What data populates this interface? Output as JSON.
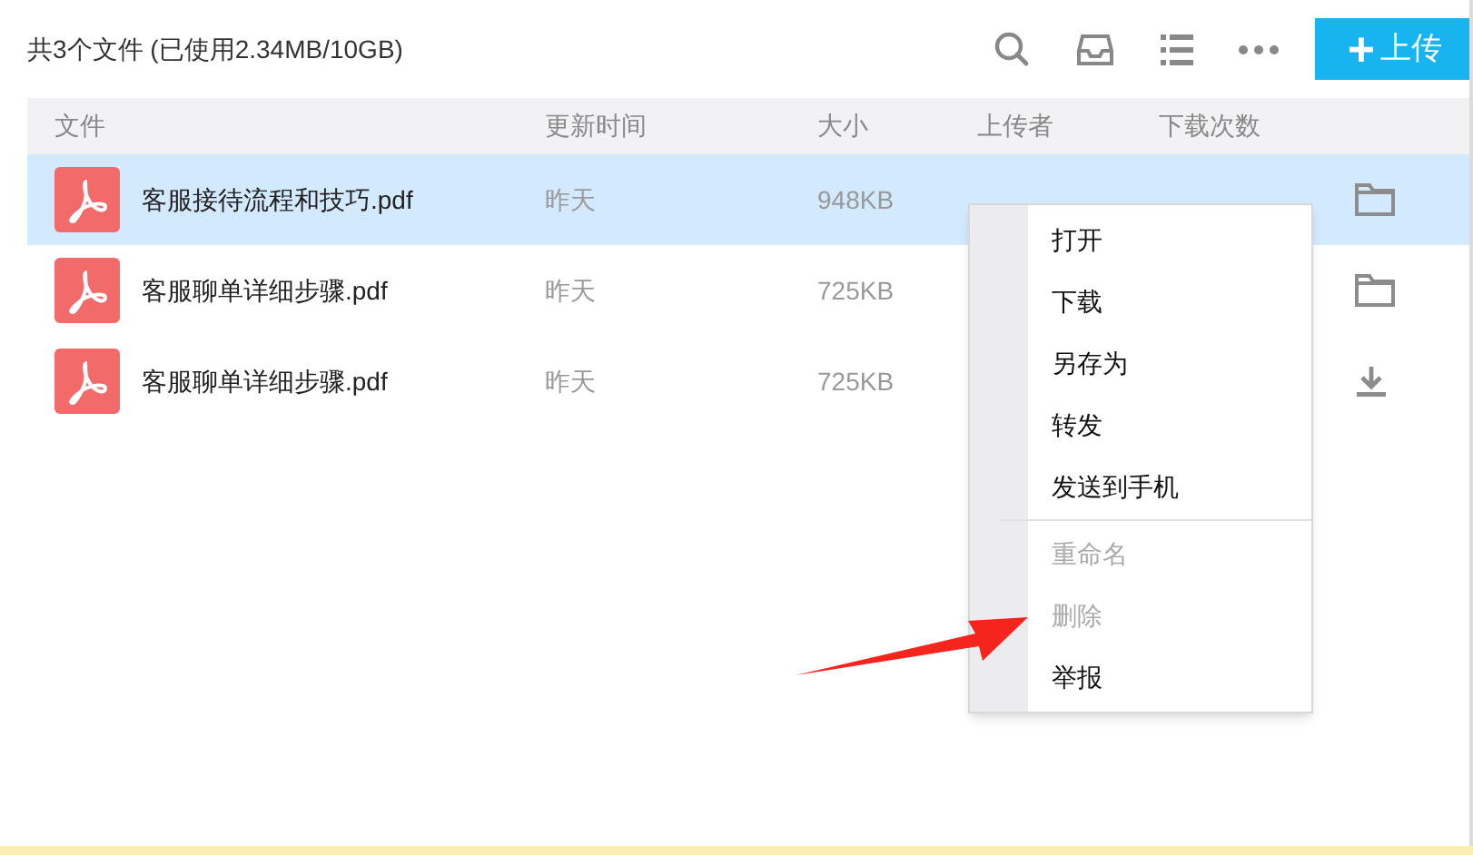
{
  "summary": "共3个文件 (已使用2.34MB/10GB)",
  "toolbar": {
    "upload_label": "上传",
    "upload_plus": "+"
  },
  "table": {
    "columns": [
      "文件",
      "更新时间",
      "大小",
      "上传者",
      "下载次数"
    ],
    "rows": [
      {
        "name": "客服接待流程和技巧.pdf",
        "updated": "昨天",
        "size": "948KB",
        "kind": "folder",
        "selected": true
      },
      {
        "name": "客服聊单详细步骤.pdf",
        "updated": "昨天",
        "size": "725KB",
        "kind": "folder",
        "selected": false
      },
      {
        "name": "客服聊单详细步骤.pdf",
        "updated": "昨天",
        "size": "725KB",
        "kind": "download",
        "selected": false
      }
    ]
  },
  "context_menu": {
    "groups": [
      [
        {
          "label": "打开",
          "disabled": false
        },
        {
          "label": "下载",
          "disabled": false
        },
        {
          "label": "另存为",
          "disabled": false
        },
        {
          "label": "转发",
          "disabled": false
        },
        {
          "label": "发送到手机",
          "disabled": false
        }
      ],
      [
        {
          "label": "重命名",
          "disabled": true
        },
        {
          "label": "删除",
          "disabled": true
        },
        {
          "label": "举报",
          "disabled": false
        }
      ]
    ]
  }
}
